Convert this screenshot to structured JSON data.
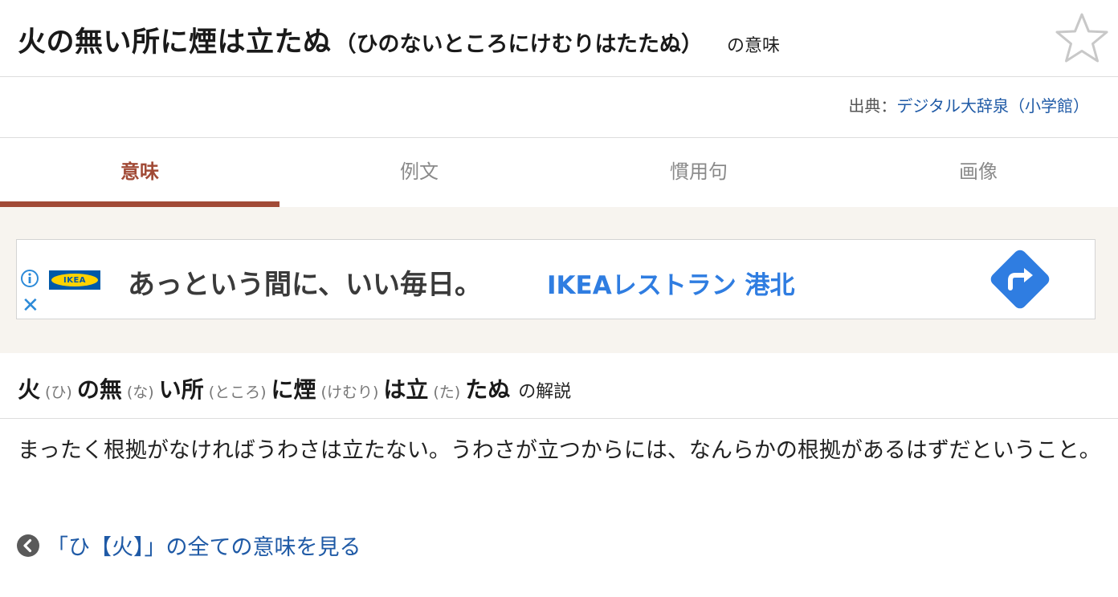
{
  "header": {
    "title": "火の無い所に煙は立たぬ",
    "reading": "（ひのないところにけむりはたたぬ）",
    "suffix": "の意味",
    "star_icon": "star-outline-icon"
  },
  "source": {
    "label": "出典：",
    "dictionary": "デジタル大辞泉（小学館）"
  },
  "tabs": [
    {
      "label": "意味",
      "active": true
    },
    {
      "label": "例文",
      "active": false
    },
    {
      "label": "慣用句",
      "active": false
    },
    {
      "label": "画像",
      "active": false
    }
  ],
  "ad": {
    "logo_text": "IKEA",
    "headline": "あっという間に、いい毎日。",
    "store": "IKEAレストラン 港北",
    "info_icon": "info-icon",
    "close_icon": "close-icon",
    "arrow_icon": "directions-arrow-icon",
    "colors": {
      "store": "#2f7de1",
      "arrow": "#2f7de1",
      "logo_blue": "#0059a8",
      "logo_yellow": "#ffd200"
    }
  },
  "commentary": {
    "ruby": [
      {
        "base": "火",
        "reading": "(ひ)"
      },
      {
        "base": "の無",
        "reading": "(な)"
      },
      {
        "base": "い所",
        "reading": "(ところ)"
      },
      {
        "base": "に煙",
        "reading": "(けむり)"
      },
      {
        "base": "は立",
        "reading": "(た)"
      },
      {
        "base": "たぬ",
        "reading": ""
      }
    ],
    "suffix": "の解説",
    "definition": "まったく根拠がなければうわさは立たない。うわさが立つからには、なんらかの根拠があるはずだということ。",
    "all_meanings_link": "「ひ【火】」の全ての意味を見る"
  },
  "colors": {
    "accent": "#a14a36",
    "link": "#1f5aa6",
    "band": "#f7f4ef"
  }
}
